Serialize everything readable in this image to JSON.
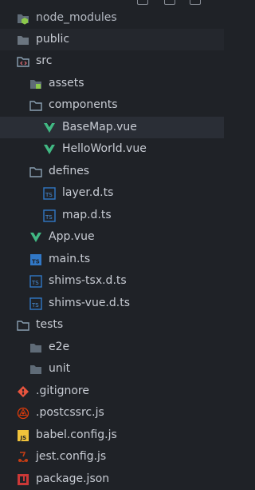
{
  "tree": {
    "items": [
      {
        "label": "node_modules",
        "icon": "folder-node-icon"
      },
      {
        "label": "public",
        "icon": "folder-icon"
      },
      {
        "label": "src",
        "icon": "folder-src-open-icon"
      },
      {
        "label": "assets",
        "icon": "folder-assets-icon"
      },
      {
        "label": "components",
        "icon": "folder-open-icon"
      },
      {
        "label": "BaseMap.vue",
        "icon": "vue-icon"
      },
      {
        "label": "HelloWorld.vue",
        "icon": "vue-icon"
      },
      {
        "label": "defines",
        "icon": "folder-open-icon"
      },
      {
        "label": "layer.d.ts",
        "icon": "typescript-def-icon"
      },
      {
        "label": "map.d.ts",
        "icon": "typescript-def-icon"
      },
      {
        "label": "App.vue",
        "icon": "vue-icon"
      },
      {
        "label": "main.ts",
        "icon": "typescript-icon"
      },
      {
        "label": "shims-tsx.d.ts",
        "icon": "typescript-def-icon"
      },
      {
        "label": "shims-vue.d.ts",
        "icon": "typescript-def-icon"
      },
      {
        "label": "tests",
        "icon": "folder-test-open-icon"
      },
      {
        "label": "e2e",
        "icon": "folder-icon"
      },
      {
        "label": "unit",
        "icon": "folder-icon"
      },
      {
        "label": ".gitignore",
        "icon": "git-icon"
      },
      {
        "label": ".postcssrc.js",
        "icon": "postcss-icon"
      },
      {
        "label": "babel.config.js",
        "icon": "javascript-icon"
      },
      {
        "label": "jest.config.js",
        "icon": "jest-icon"
      },
      {
        "label": "package.json",
        "icon": "npm-icon"
      }
    ]
  },
  "colors": {
    "background": "#1f2227",
    "selected": "#2a2e36",
    "vue": "#41b883",
    "typescript": "#3178c6",
    "folder": "#8aa0b2",
    "git": "#e8543e",
    "js": "#f0c23b",
    "npm": "#cb3837"
  }
}
